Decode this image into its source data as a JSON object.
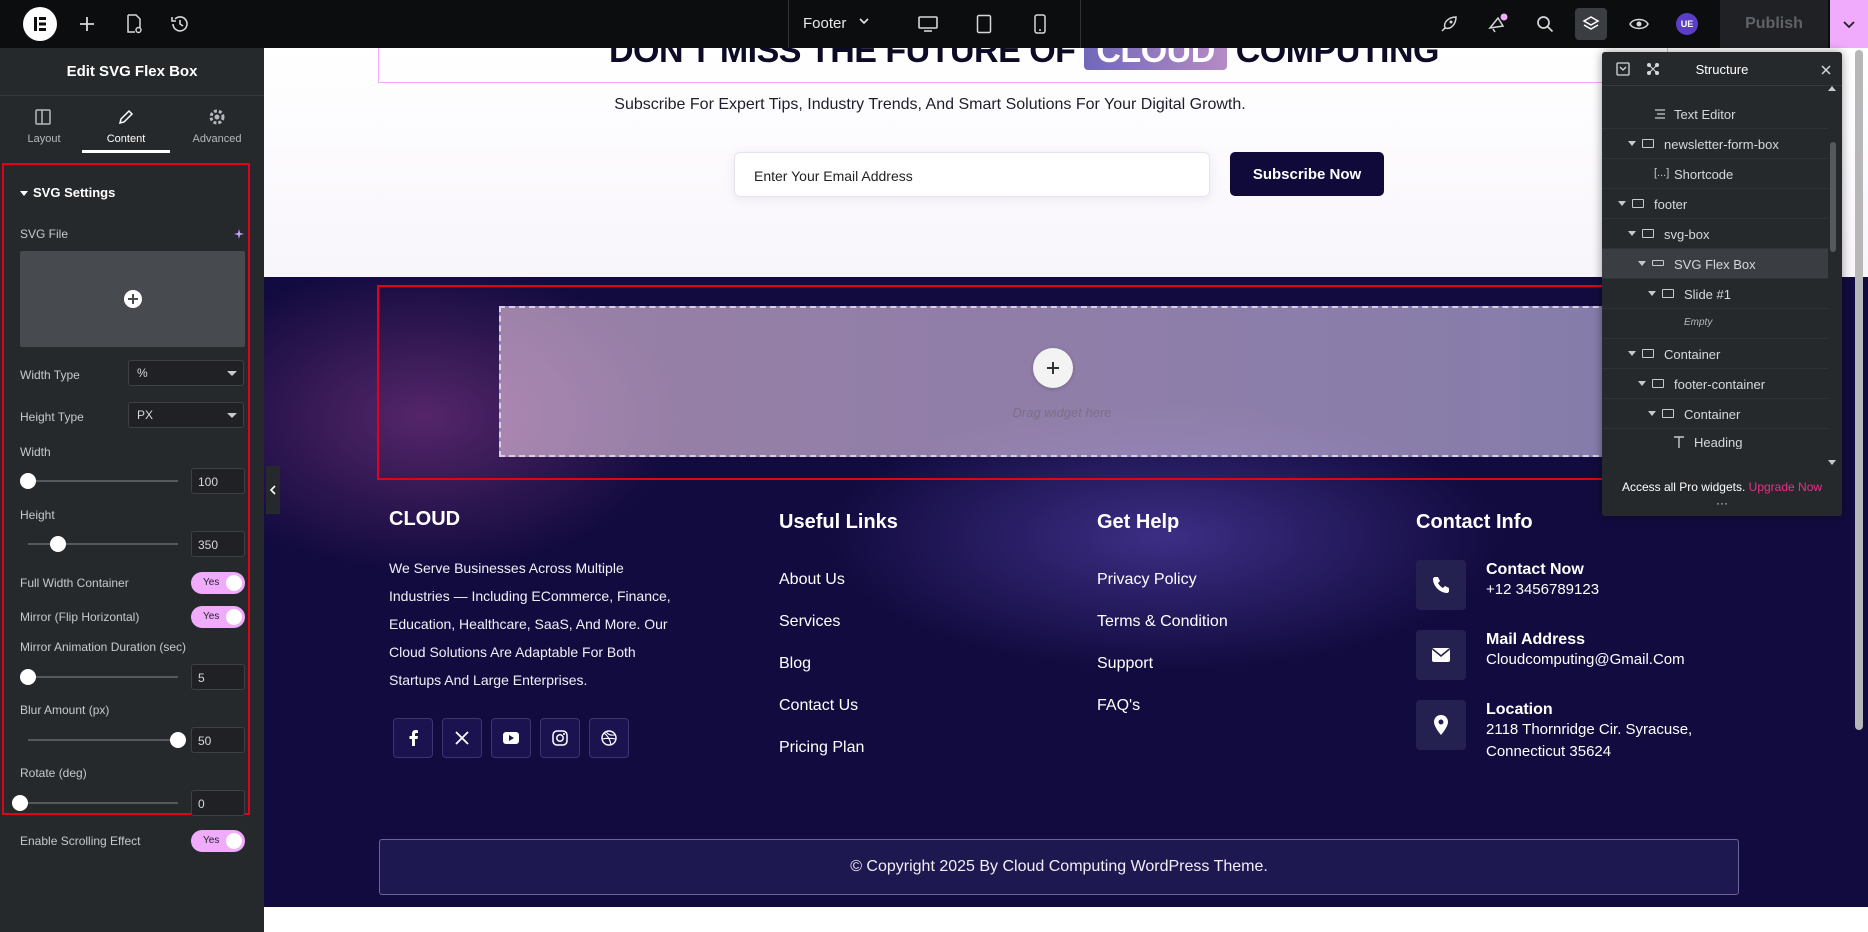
{
  "topbar": {
    "logo": "elementor-logo",
    "document_name": "Footer",
    "publish_label": "Publish",
    "user_badge": "UE",
    "accent": "#f0abfc"
  },
  "panel": {
    "title": "Edit SVG Flex Box",
    "tabs": [
      {
        "label": "Layout",
        "icon": "layout-icon"
      },
      {
        "label": "Content",
        "icon": "pencil-icon"
      },
      {
        "label": "Advanced",
        "icon": "gear-icon"
      }
    ],
    "section_title": "SVG Settings",
    "svg_file_label": "SVG File",
    "width_type": {
      "label": "Width Type",
      "value": "%"
    },
    "height_type": {
      "label": "Height Type",
      "value": "PX"
    },
    "width": {
      "label": "Width",
      "value": "100",
      "fraction": 0.0
    },
    "height": {
      "label": "Height",
      "value": "350",
      "fraction": 0.2
    },
    "full_width": {
      "label": "Full Width Container",
      "value": "Yes"
    },
    "mirror": {
      "label": "Mirror (Flip Horizontal)",
      "value": "Yes"
    },
    "mirror_duration": {
      "label": "Mirror Animation Duration (sec)",
      "value": "5",
      "fraction": 0.0
    },
    "blur": {
      "label": "Blur Amount (px)",
      "value": "50",
      "fraction": 1.0
    },
    "rotate": {
      "label": "Rotate (deg)",
      "value": "0",
      "fraction": 0.0
    },
    "scrolling": {
      "label": "Enable Scrolling Effect",
      "value": "Yes"
    }
  },
  "newsletter": {
    "title_before": "DON'T MISS THE FUTURE OF",
    "title_highlight": "CLOUD",
    "title_after": "COMPUTING",
    "subtitle": "Subscribe For Expert Tips, Industry Trends, And Smart Solutions For Your Digital Growth.",
    "email_placeholder": "Enter Your Email Address",
    "button": "Subscribe Now"
  },
  "dropzone": {
    "text": "Drag widget here"
  },
  "footer": {
    "brand": "CLOUD",
    "about": "We Serve Businesses Across Multiple Industries — Including ECommerce, Finance, Education, Healthcare, SaaS, And More. Our Cloud Solutions Are Adaptable For Both Startups And Large Enterprises.",
    "useful_title": "Useful Links",
    "useful_links": [
      "About Us",
      "Services",
      "Blog",
      "Contact Us",
      "Pricing Plan"
    ],
    "help_title": "Get Help",
    "help_links": [
      "Privacy Policy",
      "Terms & Condition",
      "Support",
      "FAQ's"
    ],
    "contact_title": "Contact Info",
    "contacts": [
      {
        "title": "Contact Now",
        "value": "+12 3456789123",
        "icon": "phone-icon"
      },
      {
        "title": "Mail Address",
        "value": "Cloudcomputing@Gmail.Com",
        "icon": "mail-icon"
      },
      {
        "title": "Location",
        "value": "2118 Thornridge Cir. Syracuse, Connecticut 35624",
        "icon": "location-icon"
      }
    ],
    "socials": [
      "facebook-icon",
      "x-icon",
      "youtube-icon",
      "instagram-icon",
      "dribbble-icon"
    ],
    "copyright": "© Copyright 2025 By Cloud Computing WordPress Theme."
  },
  "structure": {
    "title": "Structure",
    "nodes": [
      {
        "label": "Text Editor"
      },
      {
        "label": "newsletter-form-box"
      },
      {
        "label": "Shortcode"
      },
      {
        "label": "footer"
      },
      {
        "label": "svg-box"
      },
      {
        "label": "SVG Flex Box"
      },
      {
        "label": "Slide #1"
      },
      {
        "label": "Empty"
      },
      {
        "label": "Container"
      },
      {
        "label": "footer-container"
      },
      {
        "label": "Container"
      },
      {
        "label": "Heading"
      }
    ],
    "promo": "Access all Pro widgets.",
    "upgrade": "Upgrade Now"
  }
}
